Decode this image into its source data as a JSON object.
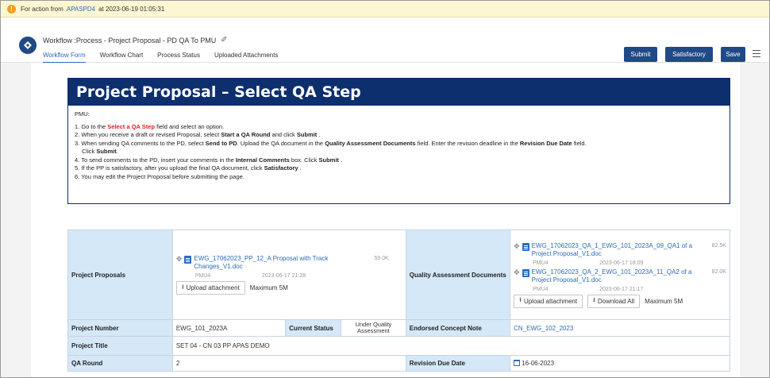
{
  "alert": {
    "prefix": "For action from",
    "from": "APASPD4",
    "at": "at 2023-06-19 01:05:31"
  },
  "header": {
    "title": "Workflow :Process - Project Proposal - PD QA To PMU",
    "tabs": [
      "Workflow Form",
      "Workflow Chart",
      "Process Status",
      "Uploaded Attachments"
    ],
    "buttons": {
      "submit": "Submit",
      "satisfactory": "Satisfactory",
      "save": "Save"
    }
  },
  "banner": {
    "title": "Project Proposal – Select QA Step"
  },
  "instructions": {
    "pmu": "PMU:",
    "l1_pre": "1. Go to the ",
    "l1_red": "Select a QA Step",
    "l1_post": " field and select an option.",
    "l2_pre": "2. When you receive a draft or revised Proposal, select ",
    "l2_b1": "Start a QA Round",
    "l2_mid": " and click ",
    "l2_b2": "Submit",
    "l2_post": " .",
    "l3_a": "3. When sending QA comments to the PD, select ",
    "l3_b1": "Send to PD",
    "l3_c": ". Upload the QA document in the ",
    "l3_b2": "Quality Assessment Documents",
    "l3_d": " field. Enter the revision deadline in the ",
    "l3_b3": "Revision Due Date",
    "l3_e": " field.",
    "l3_f": "Click ",
    "l3_b4": "Submit",
    "l3_g": ".",
    "l4_a": "4. To send comments to the PD, insert your comments in the ",
    "l4_b1": "Internal Comments",
    "l4_c": " box. Click ",
    "l4_b2": "Submit",
    "l4_d": " .",
    "l5_a": "5. If the PP is satisfactory, after you upload the final QA document, click ",
    "l5_b1": "Satisfactory",
    "l5_c": " .",
    "l6": "6. You may edit the Project Proposal before submitting the page."
  },
  "form": {
    "project_proposals": {
      "label": "Project Proposals",
      "file": {
        "name": "EWG_17062023_PP_12_A Proposal with Track Changes_V1.doc",
        "size": "59.0K",
        "user": "PMU4",
        "date": "2023-06-17 21:28"
      },
      "upload_label": "Upload attachment",
      "max_label": "Maximum 5M"
    },
    "qa_docs": {
      "label": "Quality Assessment Documents",
      "files": [
        {
          "name": "EWG_17062023_QA_1_EWG_101_2023A_09_QA1 of a Project Proposal_V1.doc",
          "size": "82.5K",
          "user": "PMU4",
          "date": "2023-06-17 18:09"
        },
        {
          "name": "EWG_17062023_QA_2_EWG_101_2023A_11_QA2 of a Project Proposal_V1.doc",
          "size": "82.0K",
          "user": "PMU4",
          "date": "2023-06-17 21:17"
        }
      ],
      "upload_label": "Upload attachment",
      "download_label": "Download All",
      "max_label": "Maximum 5M"
    },
    "project_number": {
      "label": "Project Number",
      "value": "EWG_101_2023A"
    },
    "current_status": {
      "label": "Current Status",
      "value": "Under Quality Assessment"
    },
    "endorsed_concept_note": {
      "label": "Endorsed Concept Note",
      "value": "CN_EWG_102_2023"
    },
    "project_title": {
      "label": "Project Title",
      "value": "SET 04 - CN 03 PP APAS DEMO"
    },
    "qa_round": {
      "label": "QA Round",
      "value": "2"
    },
    "revision_due_date": {
      "label": "Revision Due Date",
      "value": "16-06-2023"
    }
  }
}
